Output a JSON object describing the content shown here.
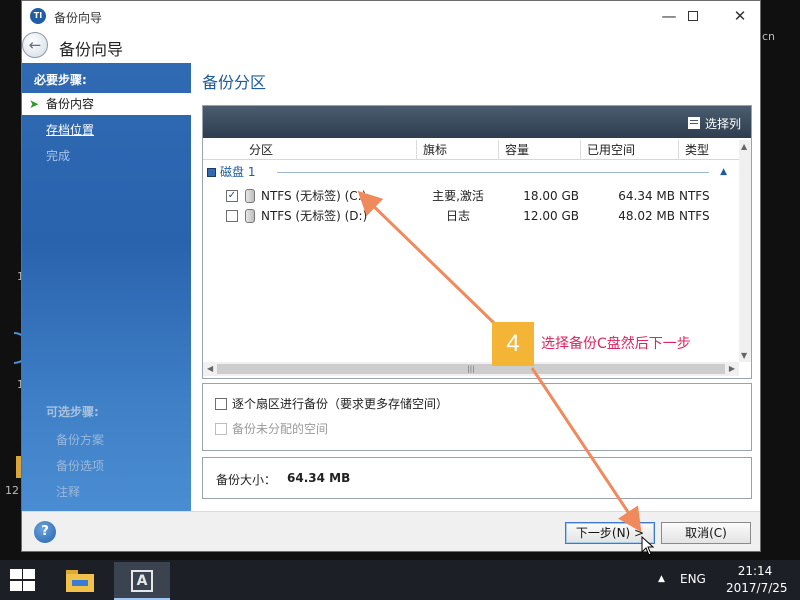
{
  "window": {
    "title": "备份向导",
    "header_title": "备份向导",
    "minimize_glyph": "—",
    "close_glyph": "✕"
  },
  "sidebar": {
    "required_heading": "必要步骤:",
    "items": [
      {
        "label": "备份内容",
        "state": "active"
      },
      {
        "label": "存档位置",
        "state": "link"
      },
      {
        "label": "完成",
        "state": "disabled"
      }
    ],
    "optional_heading": "可选步骤:",
    "optional_items": [
      "备份方案",
      "备份选项",
      "注释"
    ]
  },
  "main": {
    "section_title": "备份分区",
    "choose_columns_label": "选择列",
    "columns": [
      "分区",
      "旗标",
      "容量",
      "已用空间",
      "类型"
    ],
    "disk_label": "磁盘 1",
    "partitions": [
      {
        "name": "NTFS (无标签) (C:)",
        "flags": "主要,激活",
        "capacity": "18.00 GB",
        "used": "64.34 MB",
        "type": "NTFS",
        "checked": true
      },
      {
        "name": "NTFS (无标签) (D:)",
        "flags": "日志",
        "capacity": "12.00 GB",
        "used": "48.02 MB",
        "type": "NTFS",
        "checked": false
      }
    ],
    "option_sector": "逐个扇区进行备份（要求更多存储空间）",
    "option_unallocated": "备份未分配的空间",
    "backup_size_label": "备份大小：",
    "backup_size_value": "64.34 MB"
  },
  "footer": {
    "help_glyph": "?",
    "next_label": "下一步(N) >",
    "cancel_label": "取消(C)"
  },
  "annotation": {
    "step_number": "4",
    "text": "选择备份C盘然后下一步",
    "badge_color": "#f4b537",
    "text_color": "#e0245e",
    "arrow_color": "#f08a5d"
  },
  "taskbar": {
    "language": "ENG",
    "time": "21:14",
    "date": "2017/7/25",
    "app_glyph": "A"
  },
  "desktop_peek": {
    "text_cn": "cn",
    "text_1a": "1",
    "text_1b": "1",
    "text_12": "12"
  },
  "icons": {
    "app": "acronis-icon",
    "back": "back-arrow-icon",
    "active_step": "green-arrow-icon",
    "columns": "column-chooser-icon",
    "disk": "disk-icon",
    "drive": "drive-icon",
    "help": "help-icon"
  }
}
